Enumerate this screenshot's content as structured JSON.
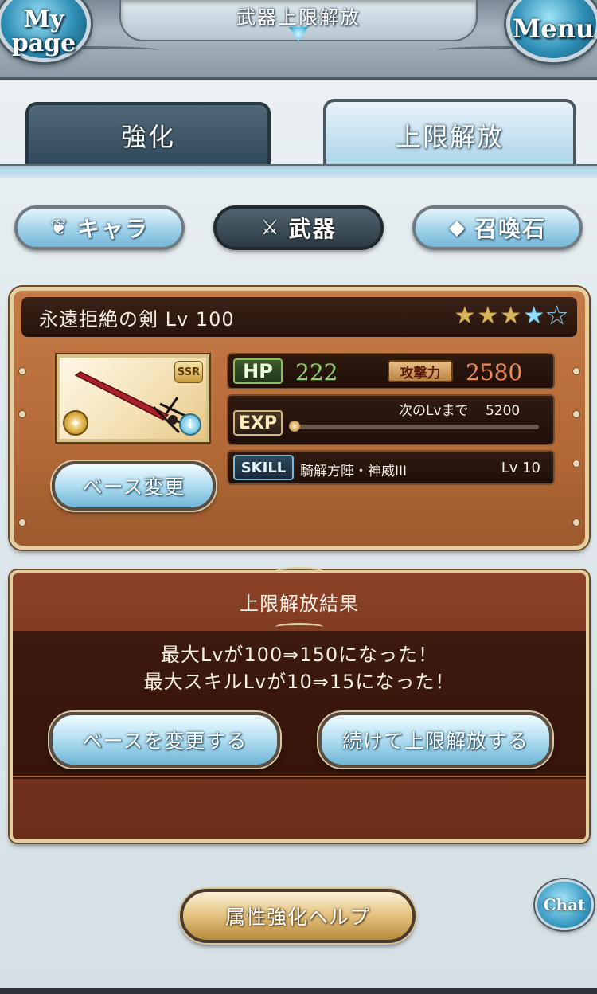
{
  "header": {
    "title": "武器上限解放",
    "mypage_label": "My page",
    "menu_label": "Menu"
  },
  "tabs": [
    {
      "label": "強化",
      "active": false
    },
    {
      "label": "上限解放",
      "active": true
    }
  ],
  "categories": [
    {
      "label": "キャラ",
      "icon": "wings-icon",
      "active": false
    },
    {
      "label": "武器",
      "icon": "crossed-swords-icon",
      "active": true
    },
    {
      "label": "召喚石",
      "icon": "crystal-icon",
      "active": false
    }
  ],
  "weapon": {
    "name": "永遠拒絶の剣 Lv 100",
    "rarity": "SSR",
    "stars_filled_gold": 3,
    "stars_filled_blue": 1,
    "stars_total": 5,
    "hp_label": "HP",
    "hp": "222",
    "atk_label": "攻撃力",
    "atk": "2580",
    "exp_label": "EXP",
    "exp_next_label": "次のLvまで",
    "exp_next_value": "5200",
    "exp_progress": 0.0,
    "skill_label": "SKILL",
    "skill_name": "騎解方陣・神威III",
    "skill_level": "Lv  10",
    "base_change_label": "ベース変更"
  },
  "result": {
    "title": "上限解放結果",
    "line1": "最大Lvが100⇒150になった！",
    "line2": "最大スキルLvが10⇒15になった！",
    "change_base_button": "ベースを変更する",
    "continue_button": "続けて上限解放する"
  },
  "help_button": "属性強化ヘルプ",
  "chat_button": "Chat",
  "colors": {
    "hp_value": "#8bd36a",
    "atk_value": "#f08a54",
    "panel_brown": "#b36a37",
    "accent_blue": "#9fd2ea"
  }
}
